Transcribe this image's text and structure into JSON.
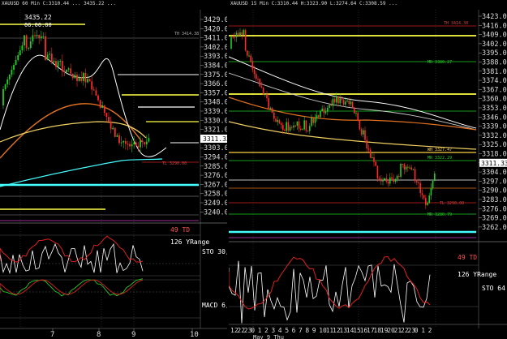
{
  "left_chart": {
    "header": "XAUUSD 60 Min  C:3310.44  ...  3435.22  ...",
    "peak_label": "3435.22",
    "peak_time": "06:00:00",
    "price_axis": [
      "3429.00",
      "3420.00",
      "3411.00",
      "3402.00",
      "3393.00",
      "3384.00",
      "3375.00",
      "3366.00",
      "3357.00",
      "3348.00",
      "3339.00",
      "3330.00",
      "3321.00",
      "3312.00",
      "3303.00",
      "3294.00",
      "3285.00",
      "3276.00",
      "3267.00",
      "3258.00",
      "3249.00",
      "3240.00"
    ],
    "current_price": "3311.33",
    "date_labels": [
      "7",
      "8",
      "9",
      "10"
    ],
    "indicator_49td": "49 TD",
    "indicator_126": "126 YRange",
    "indicator_sto": "STO  30,",
    "indicator_macd": "MACD 6,"
  },
  "right_chart": {
    "header": "XAUUSD 15 Min  C:3310.44  H:3323.90  L:3274.64  C:3308.59  ...",
    "price_axis": [
      "3423.00",
      "3416.00",
      "3409.00",
      "3402.00",
      "3395.00",
      "3388.00",
      "3381.00",
      "3374.00",
      "3367.00",
      "3360.00",
      "3353.00",
      "3346.00",
      "3339.00",
      "3332.00",
      "3325.00",
      "3318.00",
      "3311.33",
      "3304.00",
      "3297.00",
      "3290.00",
      "3283.00",
      "3276.00",
      "3269.00",
      "3262.00"
    ],
    "current_price": "3311.33",
    "time_labels": [
      "12",
      "22",
      "23",
      "0",
      "1",
      "2",
      "3",
      "4",
      "5",
      "6",
      "7",
      "8",
      "9",
      "10",
      "11",
      "12",
      "13",
      "14",
      "15",
      "16",
      "17",
      "18",
      "19",
      "20",
      "21",
      "22",
      "23",
      "0",
      "1",
      "2"
    ],
    "date_label": "May 9 Thu",
    "indicator_49td": "49 TD",
    "indicator_126": "126 YRange",
    "indicator_sto": "STO  64"
  },
  "colors": {
    "candle_up": "#22cc22",
    "candle_down": "#ff2a2a",
    "yellow_line": "#ffff44",
    "cyan_line": "#44ffff",
    "orange_ma": "#e07020",
    "white_ma": "#ffffff"
  }
}
